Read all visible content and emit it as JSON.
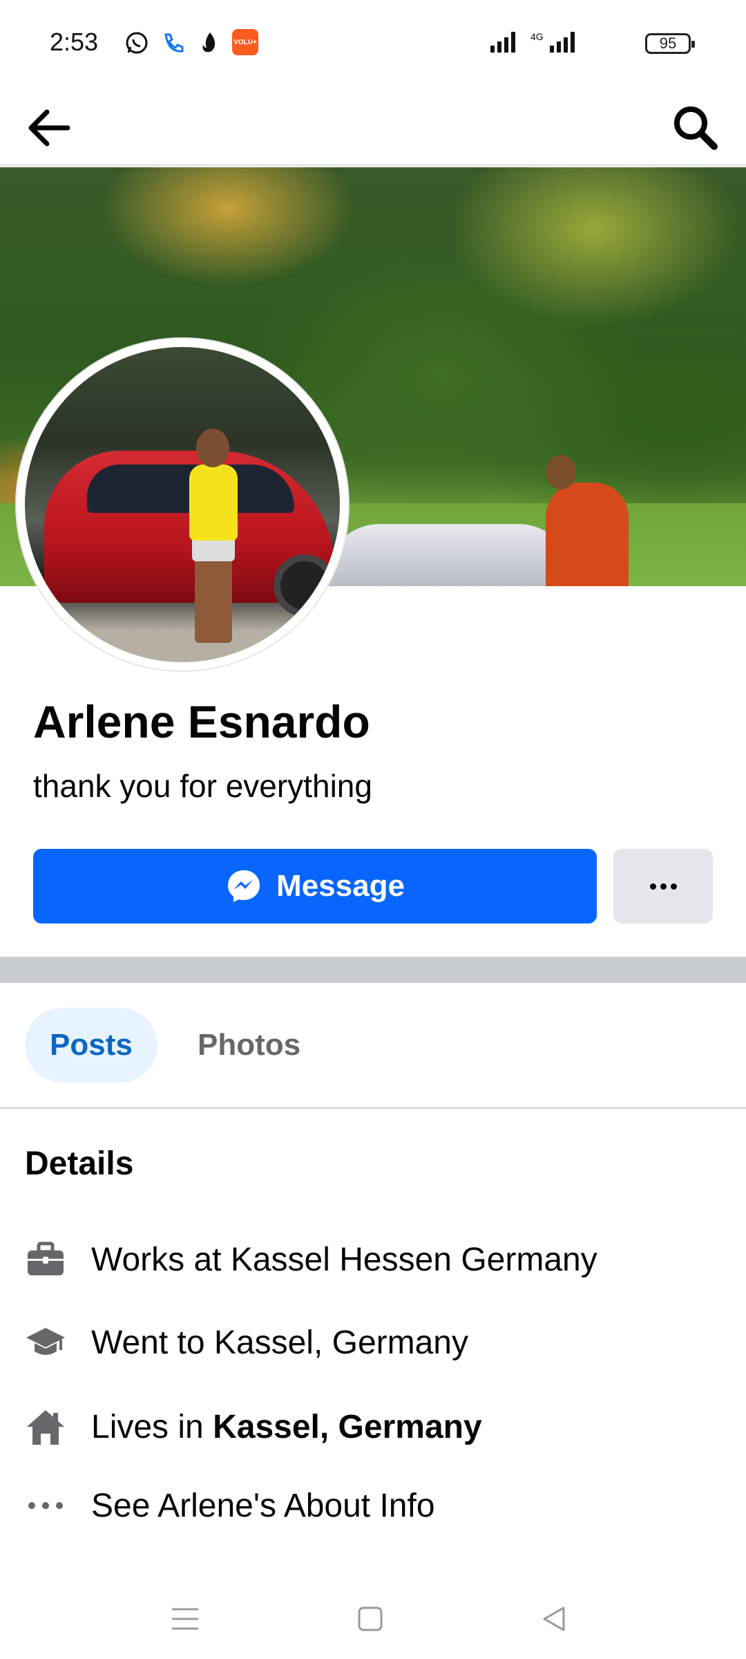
{
  "status_bar": {
    "time": "2:53",
    "network": "4G",
    "battery": "95",
    "icons": [
      "whatsapp-icon",
      "phone-icon",
      "tinder-icon",
      "volu-app-icon",
      "signal-icon",
      "battery-icon"
    ],
    "volu_label": "VOLU+"
  },
  "topnav": {
    "back": "back-arrow-icon",
    "search": "search-icon"
  },
  "profile": {
    "name": "Arlene Esnardo",
    "bio": "thank you for everything",
    "message_label": "Message",
    "accent": "#0866ff"
  },
  "tabs": [
    {
      "label": "Posts",
      "active": true
    },
    {
      "label": "Photos",
      "active": false
    }
  ],
  "details": {
    "title": "Details",
    "work": "Works at Kassel Hessen Germany",
    "education": "Went to Kassel, Germany",
    "lives_prefix": "Lives in",
    "lives_place": "Kassel, Germany",
    "about": "See Arlene's About Info"
  },
  "navbar": {
    "icons": [
      "menu-icon",
      "home-square-icon",
      "back-triangle-icon"
    ]
  }
}
